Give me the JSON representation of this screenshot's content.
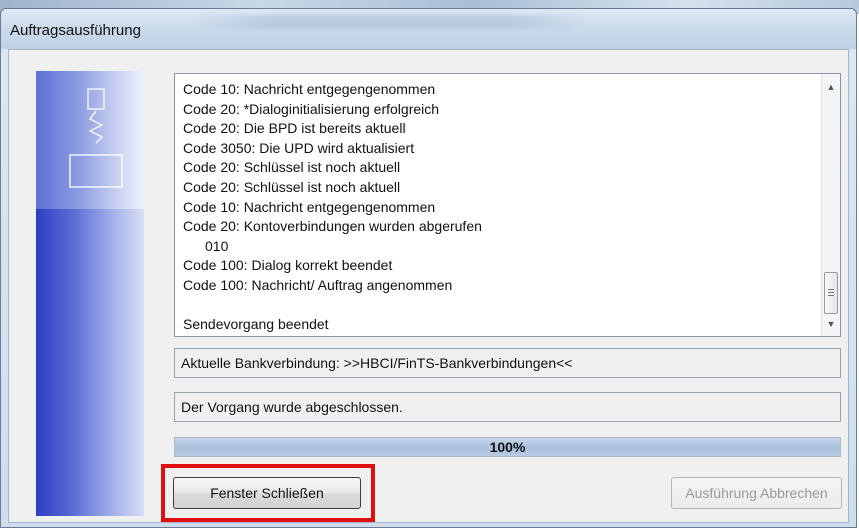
{
  "window": {
    "title": "Auftragsausführung"
  },
  "log": {
    "lines": [
      "Code 10: Nachricht entgegengenommen",
      "Code 20: *Dialoginitialisierung erfolgreich",
      "Code 20: Die BPD ist bereits aktuell",
      "Code 3050: Die UPD wird aktualisiert",
      "Code 20: Schlüssel ist noch aktuell",
      "Code 20: Schlüssel ist noch aktuell",
      "Code 10: Nachricht entgegengenommen",
      "Code 20: Kontoverbindungen wurden abgerufen",
      "010",
      "Code 100: Dialog korrekt beendet",
      "Code 100: Nachricht/ Auftrag angenommen",
      "",
      "Sendevorgang beendet"
    ],
    "scroll_up_icon": "triangle-up-icon",
    "scroll_down_icon": "triangle-down-icon"
  },
  "status": {
    "connection": "Aktuelle Bankverbindung: >>HBCI/FinTS-Bankverbindungen<<",
    "message": "Der Vorgang wurde abgeschlossen."
  },
  "progress": {
    "value": 100,
    "label": "100%"
  },
  "buttons": {
    "close_label": "Fenster Schließen",
    "abort_label": "Ausführung Abbrechen"
  },
  "colors": {
    "highlight": "#e01010",
    "side_panel": "#2e3ec3",
    "progress_fill": "#a9c0dc"
  }
}
